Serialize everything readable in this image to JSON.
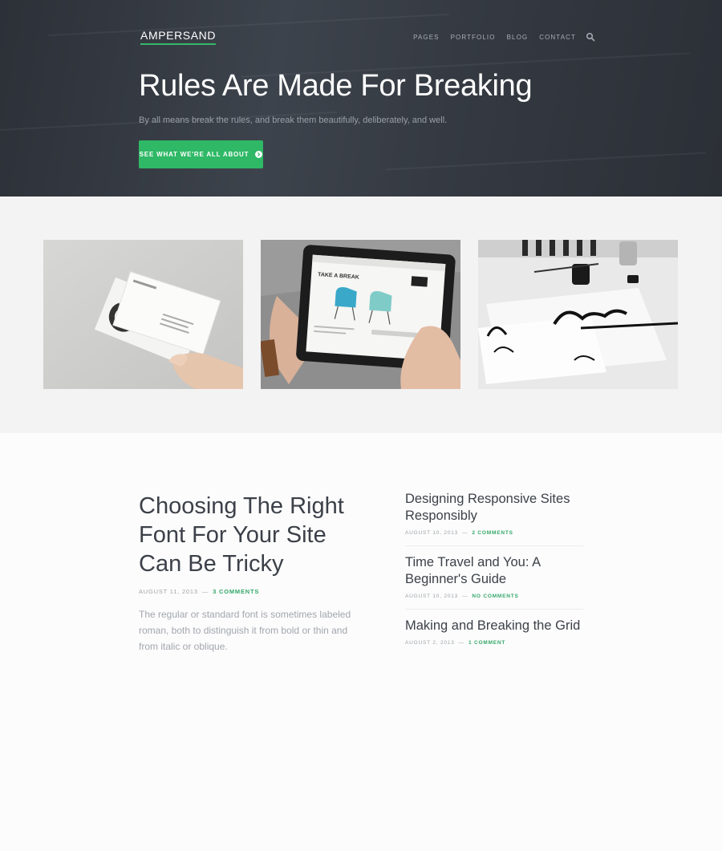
{
  "header": {
    "logo": "AMPERSAND",
    "nav": [
      "PAGES",
      "PORTFOLIO",
      "BLOG",
      "CONTACT"
    ],
    "search_icon": "search-icon"
  },
  "hero": {
    "title": "Rules Are Made For Breaking",
    "subtitle": "By all means break the rules, and break them beautifully, deliberately, and well.",
    "button_label": "SEE WHAT WE'RE ALL ABOUT",
    "button_icon": "arrow-circle-right-icon"
  },
  "gallery": {
    "items": [
      "business-cards-photo",
      "tablet-photo",
      "calligraphy-photo"
    ],
    "tablet_screen_text": "TAKE A BREAK"
  },
  "featured_post": {
    "title": "Choosing The Right Font For Your Site Can Be Tricky",
    "date": "AUGUST 11, 2013",
    "separator": "—",
    "comments": "3 COMMENTS",
    "excerpt": "The regular or standard font is sometimes labeled roman, both to distinguish it from bold or thin and from italic or oblique."
  },
  "recent_posts": [
    {
      "title": "Designing Responsive Sites Responsibly",
      "date": "AUGUST 10, 2013",
      "comments": "2 COMMENTS"
    },
    {
      "title": "Time Travel and You: A Beginner's Guide",
      "date": "AUGUST 10, 2013",
      "comments": "NO COMMENTS"
    },
    {
      "title": "Making and Breaking the Grid",
      "date": "AUGUST 2, 2013",
      "comments": "1 COMMENT"
    }
  ],
  "colors": {
    "accent": "#2fb866",
    "hero_bg": "#353a42",
    "gallery_bg": "#f3f3f3"
  }
}
